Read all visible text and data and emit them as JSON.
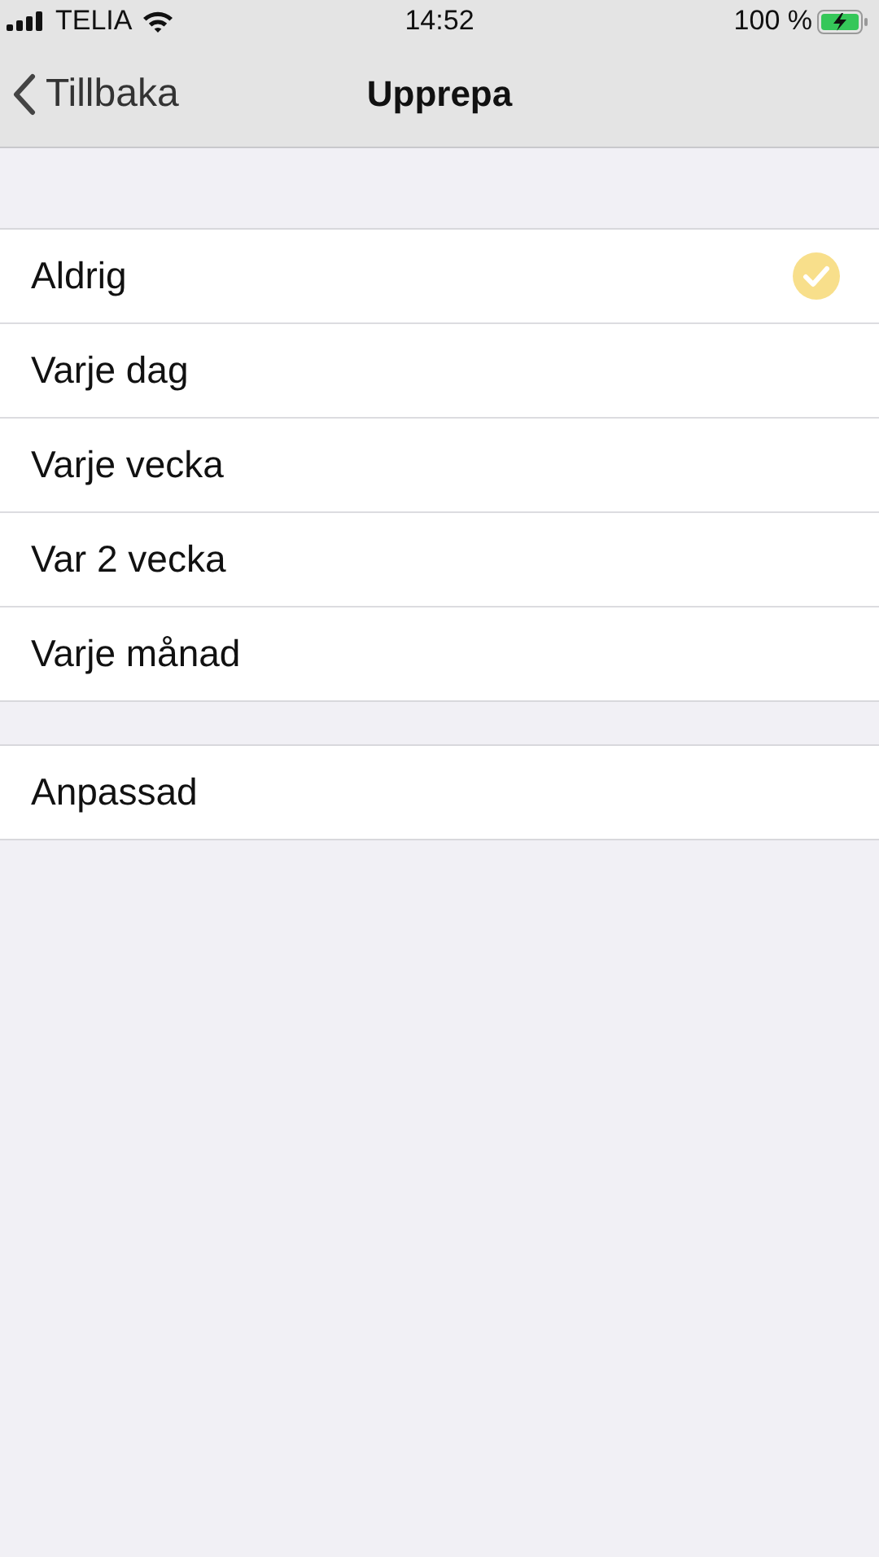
{
  "status_bar": {
    "carrier": "TELIA",
    "time": "14:52",
    "battery": "100 %"
  },
  "nav": {
    "back": "Tillbaka",
    "title": "Upprepa"
  },
  "sections": [
    {
      "items": [
        {
          "label": "Aldrig",
          "selected": true
        },
        {
          "label": "Varje dag",
          "selected": false
        },
        {
          "label": "Varje vecka",
          "selected": false
        },
        {
          "label": "Var 2 vecka",
          "selected": false
        },
        {
          "label": "Varje månad",
          "selected": false
        }
      ]
    },
    {
      "items": [
        {
          "label": "Anpassad",
          "selected": false
        }
      ]
    }
  ]
}
